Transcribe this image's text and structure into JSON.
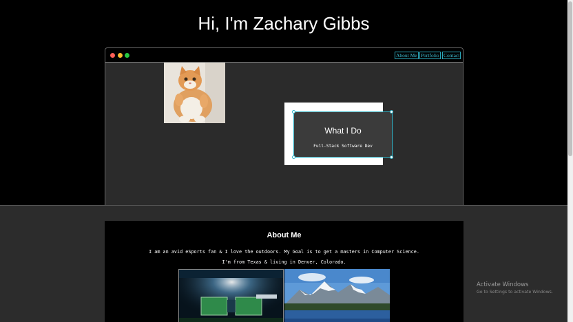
{
  "hero": {
    "title": "Hi, I'm Zachary Gibbs"
  },
  "nav": {
    "about": "About Me",
    "portfolio": "Portfolio",
    "contact": "Contact"
  },
  "window": {
    "dots": [
      "#ff5f57",
      "#febc2e",
      "#28c840"
    ]
  },
  "card": {
    "title": "What I Do",
    "subtitle": "Full-Stack Software Dev"
  },
  "about": {
    "title": "About Me",
    "line1": "I am an avid eSports fan & I love the outdoors. My Goal is to get a masters in Computer Science.",
    "line2": "I'm from Texas & living in Denver, Colorado."
  },
  "activation": {
    "title": "Activate Windows",
    "subtitle": "Go to Settings to activate Windows."
  },
  "colors": {
    "accent": "#2fb4c8",
    "page_bg": "#000000",
    "section_bg": "#2c2c2c"
  },
  "icons": [
    "cat-photo",
    "esports-arena-photo",
    "mountain-lake-photo"
  ]
}
